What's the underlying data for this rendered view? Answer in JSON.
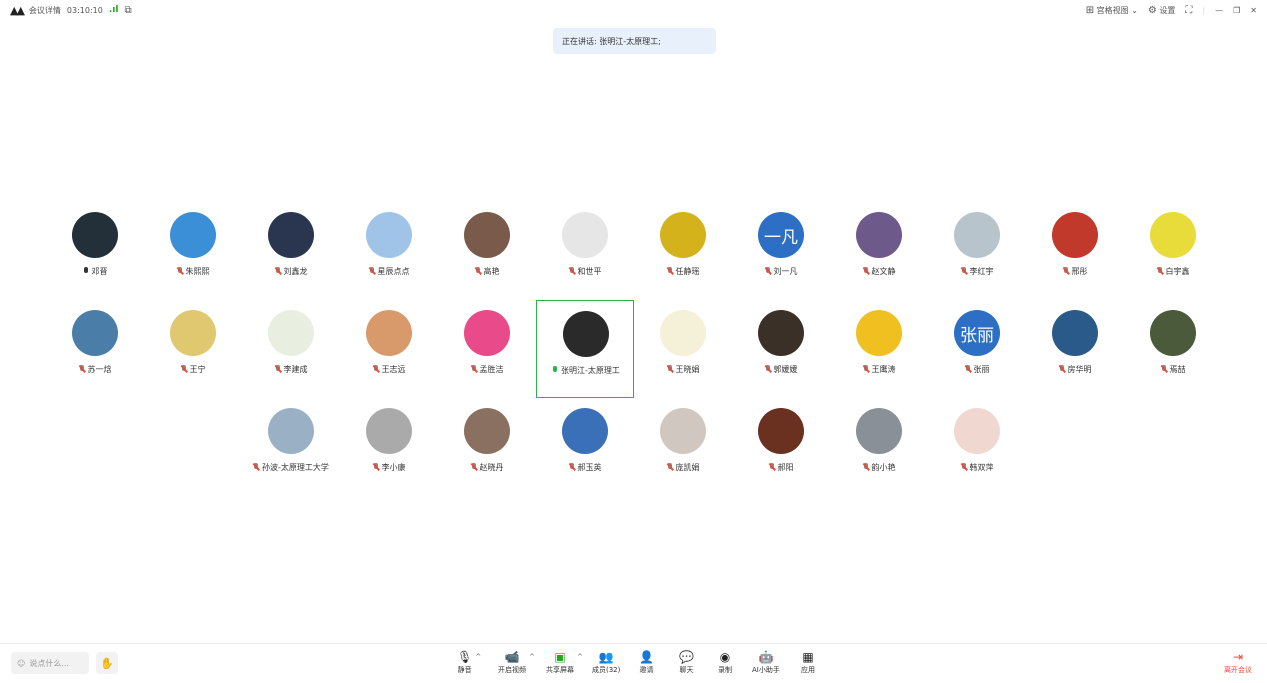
{
  "header": {
    "meeting_info": "会议详情",
    "duration": "03:10:10",
    "view_label": "宫格视图",
    "settings_label": "设置"
  },
  "speaking": {
    "text": "正在讲话: 张明江-太原理工;"
  },
  "participants": [
    {
      "name": "邓晋",
      "mic": "on",
      "bg": "#23303a",
      "initials": ""
    },
    {
      "name": "朱熙熙",
      "mic": "off",
      "bg": "#3a8fd6",
      "initials": ""
    },
    {
      "name": "刘鑫龙",
      "mic": "off",
      "bg": "#2a3550",
      "initials": ""
    },
    {
      "name": "星辰点点",
      "mic": "off",
      "bg": "#9fc4e8",
      "initials": ""
    },
    {
      "name": "高艳",
      "mic": "off",
      "bg": "#7a5a4a",
      "initials": ""
    },
    {
      "name": "和世平",
      "mic": "off",
      "bg": "#e6e6e6",
      "initials": ""
    },
    {
      "name": "任静瑶",
      "mic": "off",
      "bg": "#d4b21c",
      "initials": ""
    },
    {
      "name": "刘一凡",
      "mic": "off",
      "bg": "#2d6fc4",
      "initials": "一凡"
    },
    {
      "name": "赵文静",
      "mic": "off",
      "bg": "#6d5a8a",
      "initials": ""
    },
    {
      "name": "李红宇",
      "mic": "off",
      "bg": "#b8c4cc",
      "initials": ""
    },
    {
      "name": "邢彤",
      "mic": "off",
      "bg": "#c0392b",
      "initials": ""
    },
    {
      "name": "白宇鑫",
      "mic": "off",
      "bg": "#e8dc3a",
      "initials": ""
    },
    {
      "name": "苏一焓",
      "mic": "off",
      "bg": "#4a7ea8",
      "initials": ""
    },
    {
      "name": "王宁",
      "mic": "off",
      "bg": "#e0c870",
      "initials": ""
    },
    {
      "name": "李建成",
      "mic": "off",
      "bg": "#e8efe0",
      "initials": ""
    },
    {
      "name": "王志远",
      "mic": "off",
      "bg": "#d89a6a",
      "initials": ""
    },
    {
      "name": "孟胜洁",
      "mic": "off",
      "bg": "#e84a8a",
      "initials": ""
    },
    {
      "name": "张明江-太原理工",
      "mic": "on-green",
      "bg": "#2a2a2a",
      "initials": "",
      "active": true
    },
    {
      "name": "王晓娟",
      "mic": "off",
      "bg": "#f5f0d8",
      "initials": ""
    },
    {
      "name": "郭媛媛",
      "mic": "off",
      "bg": "#3a3028",
      "initials": ""
    },
    {
      "name": "王鹰涛",
      "mic": "off",
      "bg": "#f0c020",
      "initials": ""
    },
    {
      "name": "张丽",
      "mic": "off",
      "bg": "#2d6fc4",
      "initials": "张丽"
    },
    {
      "name": "房华明",
      "mic": "off",
      "bg": "#2a5a8a",
      "initials": ""
    },
    {
      "name": "焉喆",
      "mic": "off",
      "bg": "#4a5a3a",
      "initials": ""
    },
    {
      "name": "孙波-太原理工大学",
      "mic": "off",
      "bg": "#9ab0c4",
      "initials": ""
    },
    {
      "name": "李小康",
      "mic": "off",
      "bg": "#aaaaaa",
      "initials": ""
    },
    {
      "name": "赵晓丹",
      "mic": "off",
      "bg": "#8a7060",
      "initials": ""
    },
    {
      "name": "郝玉英",
      "mic": "off",
      "bg": "#3a70b8",
      "initials": ""
    },
    {
      "name": "庞凯娟",
      "mic": "off",
      "bg": "#d0c8c0",
      "initials": ""
    },
    {
      "name": "郝阳",
      "mic": "off",
      "bg": "#6a3020",
      "initials": ""
    },
    {
      "name": "韵小艳",
      "mic": "off",
      "bg": "#8a9098",
      "initials": ""
    },
    {
      "name": "韩双萍",
      "mic": "off",
      "bg": "#f0d8d0",
      "initials": ""
    }
  ],
  "toolbar": {
    "chat_placeholder": "说点什么...",
    "mute": "静音",
    "video": "开启视频",
    "share": "共享屏幕",
    "members": "成员(32)",
    "invite": "邀请",
    "chat": "聊天",
    "record": "录制",
    "ai": "AI小助手",
    "apps": "应用",
    "leave": "离开会议"
  }
}
